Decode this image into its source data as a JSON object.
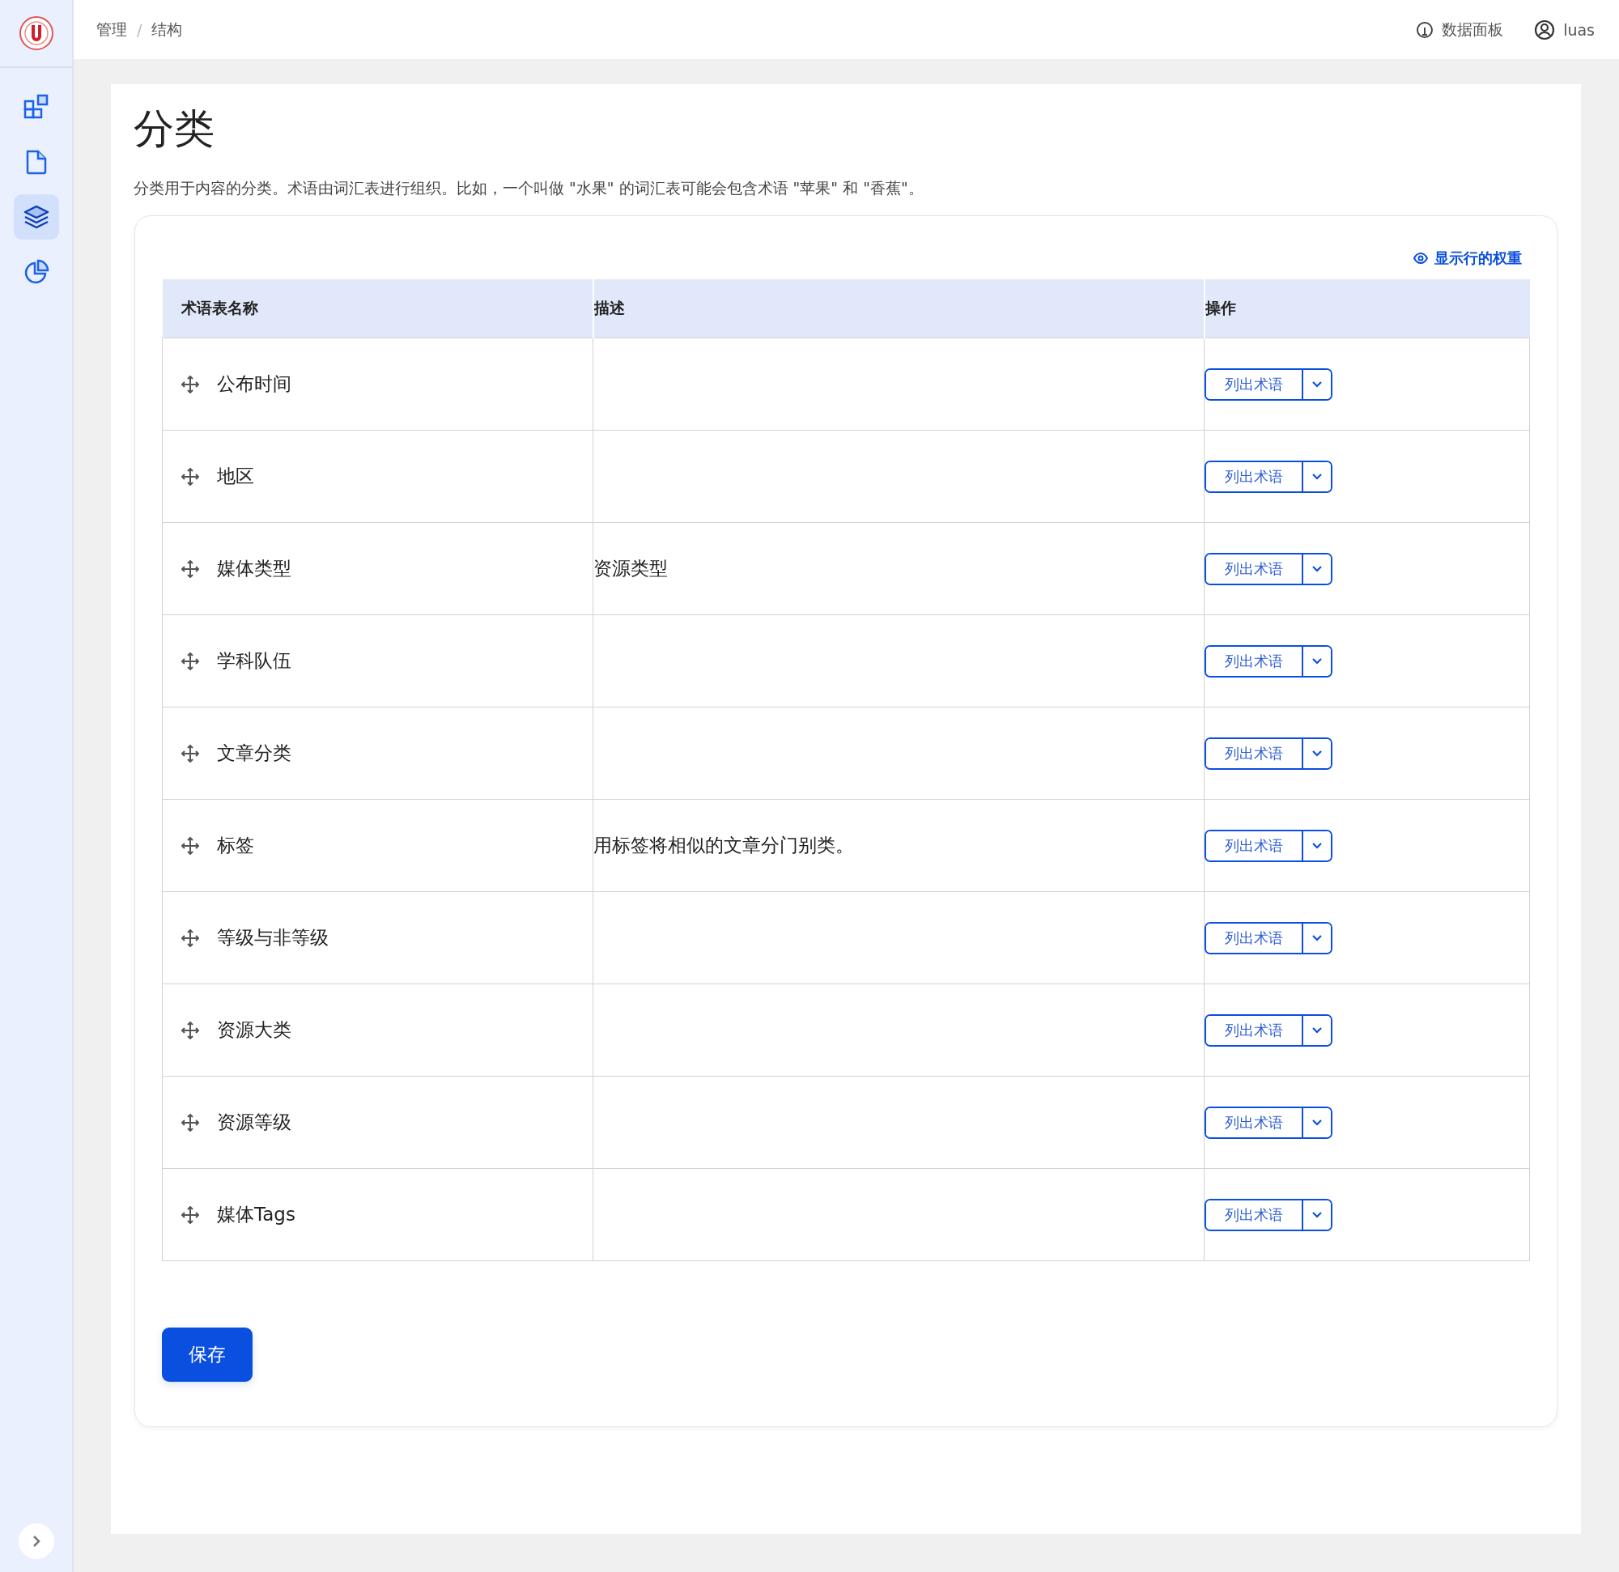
{
  "sidebar": {
    "items": [
      {
        "selected": false
      },
      {
        "selected": false
      },
      {
        "selected": true
      },
      {
        "selected": false
      }
    ]
  },
  "topbar": {
    "breadcrumb": [
      "管理",
      "结构"
    ],
    "separator": "/",
    "dashboard_link": "数据面板",
    "user": "luas"
  },
  "page": {
    "title": "分类",
    "description": "分类用于内容的分类。术语由词汇表进行组织。比如，一个叫做 \"水果\" 的词汇表可能会包含术语 \"苹果\" 和 \"香蕉\"。",
    "show_weights_link": "显示行的权重"
  },
  "table": {
    "columns": [
      "术语表名称",
      "描述",
      "操作"
    ],
    "rows": [
      {
        "name": "公布时间",
        "action": "列出术语"
      },
      {
        "name": "地区",
        "action": "列出术语"
      },
      {
        "name": "媒体类型",
        "description": "资源类型",
        "action": "列出术语"
      },
      {
        "name": "学科队伍",
        "action": "列出术语"
      },
      {
        "name": "文章分类",
        "action": "列出术语"
      },
      {
        "name": "标签",
        "description": "用标签将相似的文章分门别类。",
        "action": "列出术语"
      },
      {
        "name": "等级与非等级",
        "action": "列出术语"
      },
      {
        "name": "资源大类",
        "action": "列出术语"
      },
      {
        "name": "资源等级",
        "action": "列出术语"
      },
      {
        "name": "媒体Tags",
        "action": "列出术语"
      }
    ]
  },
  "save_button": "保存"
}
